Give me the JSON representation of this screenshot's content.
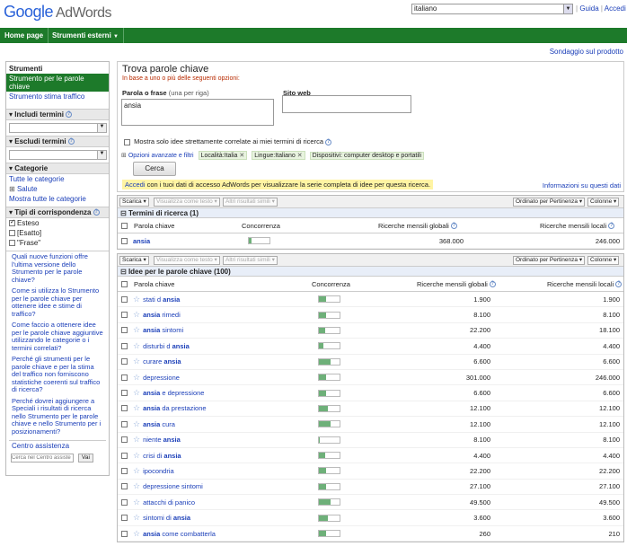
{
  "header": {
    "logo_google": "Google",
    "logo_product": "AdWords",
    "language": "italiano",
    "links": [
      "Guida",
      "Accedi"
    ]
  },
  "nav": {
    "items": [
      "Home page",
      "Strumenti esterni"
    ]
  },
  "survey_link": "Sondaggio sul prodotto",
  "sidebar": {
    "tools_title": "Strumenti",
    "tool_selected": "Strumento per le parole chiave",
    "tool_other": "Strumento stima traffico",
    "include_title": "Includi termini",
    "exclude_title": "Escludi termini",
    "categories_title": "Categorie",
    "categories_all": "Tutte le categorie",
    "category_health": "Salute",
    "categories_show": "Mostra tutte le categorie",
    "match_title": "Tipi di corrispondenza",
    "match_types": [
      {
        "label": "Esteso",
        "checked": true
      },
      {
        "label": "[Esatto]",
        "checked": false
      },
      {
        "label": "\"Frase\"",
        "checked": false
      }
    ],
    "help_questions": [
      "Quali nuove funzioni offre l'ultima versione dello Strumento per le parole chiave?",
      "Come si utilizza lo Strumento per le parole chiave per ottenere idee e stime di traffico?",
      "Come faccio a ottenere idee per le parole chiave aggiuntive utilizzando le categorie o i termini correlati?",
      "Perché gli strumenti per le parole chiave e per la stima del traffico non forniscono statistiche coerenti sul traffico di ricerca?",
      "Perché dovrei aggiungere a Speciali i risultati di ricerca nello Strumento per le parole chiave e nello Strumento per i posizionamenti?"
    ],
    "help_center": "Centro assistenza",
    "help_search_placeholder": "Cerca nel Centro assiste",
    "help_search_button": "Vai"
  },
  "search": {
    "title": "Trova parole chiave",
    "subtitle": "In base a uno o più delle seguenti opzioni:",
    "phrase_label": "Parola o frase",
    "phrase_hint": "(una per riga)",
    "phrase_value": "ansia",
    "site_label": "Sito web",
    "only_related": "Mostra solo idee strettamente correlate ai miei termini di ricerca",
    "advanced": "Opzioni avanzate e filtri",
    "filters": [
      "Località:Italia",
      "Lingue:Italiano",
      "Dispositivi: computer desktop e portatili"
    ],
    "search_button": "Cerca",
    "notice_link": "Accedi",
    "notice_text": " con i tuoi dati di accesso AdWords per visualizzare la serie completa di idee per questa ricerca.",
    "info_link": "Informazioni su questi dati"
  },
  "toolbar": {
    "download": "Scarica",
    "view_as_text": "Visualizza come testo",
    "more_like": "Altri risultati simili",
    "sort": "Ordinato per Pertinenza",
    "columns": "Colonne"
  },
  "columns": {
    "keyword": "Parola chiave",
    "competition": "Concorrenza",
    "global": "Ricerche mensili globali",
    "local": "Ricerche mensili locali"
  },
  "search_terms": {
    "title": "Termini di ricerca (1)",
    "rows": [
      {
        "pre": "",
        "bold": "ansia",
        "post": "",
        "competition": 0.15,
        "global": "368.000",
        "local": "246.000"
      }
    ]
  },
  "ideas": {
    "title": "Idee per le parole chiave (100)",
    "rows": [
      {
        "pre": "stati d ",
        "bold": "ansia",
        "post": "",
        "competition": 0.35,
        "global": "1.900",
        "local": "1.900"
      },
      {
        "pre": "",
        "bold": "ansia",
        "post": " rimedi",
        "competition": 0.35,
        "global": "8.100",
        "local": "8.100"
      },
      {
        "pre": "",
        "bold": "ansia",
        "post": " sintomi",
        "competition": 0.3,
        "global": "22.200",
        "local": "18.100"
      },
      {
        "pre": "disturbi d ",
        "bold": "ansia",
        "post": "",
        "competition": 0.2,
        "global": "4.400",
        "local": "4.400"
      },
      {
        "pre": "curare ",
        "bold": "ansia",
        "post": "",
        "competition": 0.55,
        "global": "6.600",
        "local": "6.600"
      },
      {
        "pre": "depressione",
        "bold": "",
        "post": "",
        "competition": 0.35,
        "global": "301.000",
        "local": "246.000"
      },
      {
        "pre": "",
        "bold": "ansia",
        "post": " e depressione",
        "competition": 0.35,
        "global": "6.600",
        "local": "6.600"
      },
      {
        "pre": "",
        "bold": "ansia",
        "post": " da prestazione",
        "competition": 0.45,
        "global": "12.100",
        "local": "12.100"
      },
      {
        "pre": "",
        "bold": "ansia",
        "post": " cura",
        "competition": 0.55,
        "global": "12.100",
        "local": "12.100"
      },
      {
        "pre": "niente ",
        "bold": "ansia",
        "post": "",
        "competition": 0.05,
        "global": "8.100",
        "local": "8.100"
      },
      {
        "pre": "crisi di ",
        "bold": "ansia",
        "post": "",
        "competition": 0.3,
        "global": "4.400",
        "local": "4.400"
      },
      {
        "pre": "ipocondria",
        "bold": "",
        "post": "",
        "competition": 0.35,
        "global": "22.200",
        "local": "22.200"
      },
      {
        "pre": "depressione sintomi",
        "bold": "",
        "post": "",
        "competition": 0.35,
        "global": "27.100",
        "local": "27.100"
      },
      {
        "pre": "attacchi di panico",
        "bold": "",
        "post": "",
        "competition": 0.55,
        "global": "49.500",
        "local": "49.500"
      },
      {
        "pre": "sintomi di ",
        "bold": "ansia",
        "post": "",
        "competition": 0.45,
        "global": "3.600",
        "local": "3.600"
      },
      {
        "pre": "",
        "bold": "ansia",
        "post": " come combatterla",
        "competition": 0.35,
        "global": "260",
        "local": "210"
      }
    ]
  },
  "colors": {
    "nav_green": "#1d7a2a",
    "bar_green": "#6eb079",
    "link_blue": "#1a3eb8",
    "notice_yellow": "#fff4a3"
  }
}
